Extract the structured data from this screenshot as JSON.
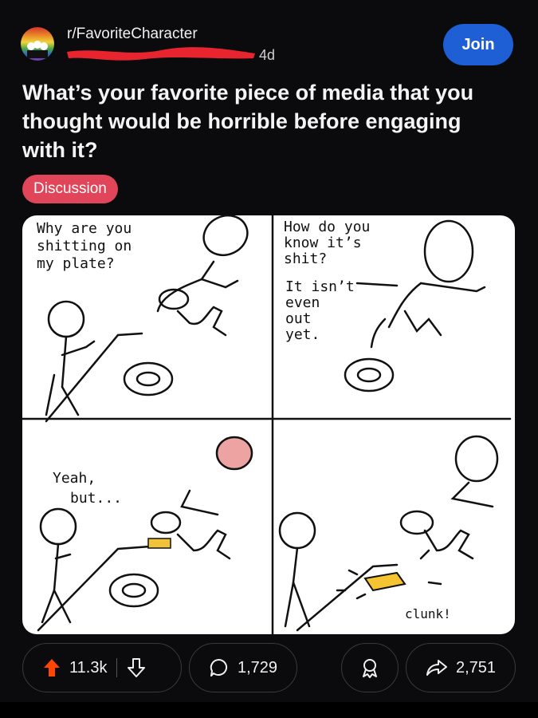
{
  "post": {
    "subreddit": "r/FavoriteCharacter",
    "age": "4d",
    "join_label": "Join",
    "title": "What’s your favorite piece of media that you thought would be horrible before engaging with it?",
    "flair": "Discussion"
  },
  "comic": {
    "panel1": [
      "Why are you",
      "shitting on",
      "my plate?"
    ],
    "panel2": [
      "How do you",
      "know it’s",
      "shit?",
      "It isn’t",
      "even",
      "out",
      "yet."
    ],
    "panel3": [
      "Yeah,",
      "but..."
    ],
    "panel4": [
      "clunk!"
    ]
  },
  "actions": {
    "upvotes": "11.3k",
    "comments": "1,729",
    "shares": "2,751"
  },
  "colors": {
    "join": "#1f5fd6",
    "flair": "#e0455a",
    "upvote": "#ff4500"
  }
}
